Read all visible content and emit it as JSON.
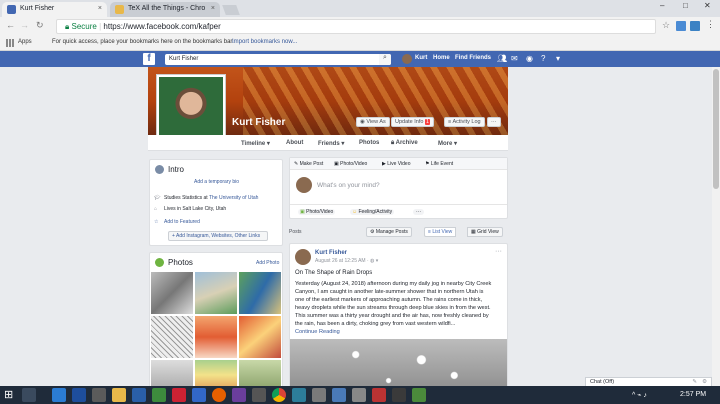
{
  "browser": {
    "tabs": [
      {
        "label": "Kurt Fisher"
      },
      {
        "label": "TeX All the Things - Chro"
      }
    ],
    "secure_label": "Secure",
    "url": "https://www.facebook.com/kafper",
    "bookmarks": {
      "apps_label": "Apps",
      "hint": "For quick access, place your bookmarks here on the bookmarks bar.",
      "import_link": "Import bookmarks now..."
    }
  },
  "fb_header": {
    "search_value": "Kurt Fisher",
    "user_short": "Kurt",
    "home_label": "Home",
    "find_friends_label": "Find Friends"
  },
  "profile": {
    "name": "Kurt Fisher",
    "buttons": {
      "view_as": "View As",
      "update_info": "Update Info",
      "update_info_badge": "1",
      "activity_log": "Activity Log",
      "more": "···"
    },
    "tabs": [
      "Timeline",
      "About",
      "Friends",
      "Photos",
      "Archive",
      "More"
    ]
  },
  "intro": {
    "title": "Intro",
    "add_bio": "Add a temporary bio",
    "studies_prefix": "Studies Statistics at",
    "studies_school": "The University of Utah",
    "lives_in": "Lives in Salt Lake City, Utah",
    "add_featured": "Add to Featured",
    "add_links": "+ Add Instagram, Websites, Other Links"
  },
  "photos": {
    "title": "Photos",
    "add_photo": "Add Photo"
  },
  "composer": {
    "actions": [
      "Make Post",
      "Photo/Video",
      "Live Video",
      "Life Event"
    ],
    "placeholder": "What's on your mind?",
    "bottom_actions": [
      "Photo/Video",
      "Feeling/Activity",
      "···"
    ]
  },
  "posts_bar": {
    "label": "Posts",
    "manage": "Manage Posts",
    "list_view": "List View",
    "grid_view": "Grid View"
  },
  "post": {
    "author": "Kurt Fisher",
    "time": "August 26 at 12:25 AM",
    "title": "On The Shape of Rain Drops",
    "lines": [
      "Yesterday (August 24, 2018) afternoon during my daily jog in nearby City Creek",
      "Canyon, I am caught in another late-summer shower that in northern Utah is",
      "one of the earliest markers of approaching autumn. The rains come in thick,",
      "heavy droplets while the sun streams through deep blue skies in from the west.",
      "This summer was a thirty year drought and the air has, now freshly cleaned by",
      "the rain, has been a dirty, choking grey from vast western wildfi..."
    ],
    "continue": "Continue Reading",
    "more": "···"
  },
  "chat": {
    "label": "Chat (Off)"
  },
  "taskbar": {
    "time": "2:57 PM"
  },
  "colors": {
    "fb_blue": "#4267b2",
    "link": "#365899",
    "taskbar": "#1f2b3a"
  }
}
